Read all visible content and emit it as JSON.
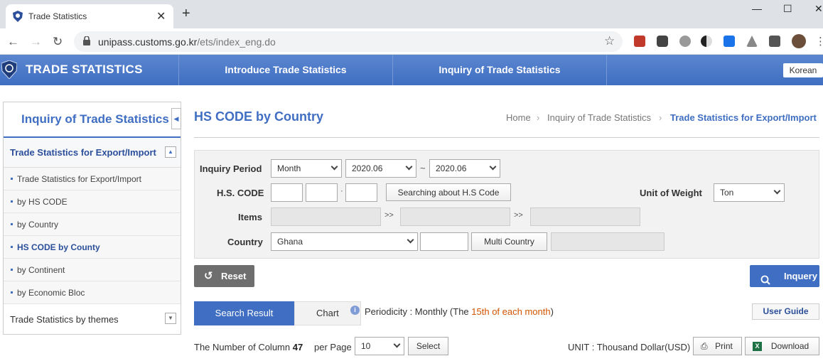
{
  "browser": {
    "tab_title": "Trade Statistics",
    "url_host": "unipass.customs.go.kr",
    "url_path": "/ets/index_eng.do"
  },
  "site": {
    "brand": "TRADE STATISTICS",
    "menu": [
      "Introduce Trade Statistics",
      "Inquiry of Trade Statistics"
    ],
    "lang_button": "Korean"
  },
  "sidebar": {
    "title": "Inquiry of Trade Statistics",
    "section": "Trade Statistics for Export/Import",
    "items": [
      "Trade Statistics for Export/Import",
      "by HS CODE",
      "by Country",
      "HS CODE by County",
      "by Continent",
      "by Economic Bloc"
    ],
    "footer_section": "Trade Statistics by themes"
  },
  "page": {
    "title": "HS CODE by Country",
    "breadcrumb": [
      "Home",
      "Inquiry of Trade Statistics",
      "Trade Statistics for Export/Import"
    ]
  },
  "form": {
    "period_label": "Inquiry Period",
    "period_type": "Month",
    "period_from": "2020.06",
    "tilde": "~",
    "period_to": "2020.06",
    "hs_label": "H.S. CODE",
    "hs_dot": "·",
    "hs_search_button": "Searching about H.S Code",
    "weight_label": "Unit of Weight",
    "weight_value": "Ton",
    "items_label": "Items",
    "arrow": ">>",
    "country_label": "Country",
    "country_value": "Ghana",
    "multi_country_button": "Multi Country"
  },
  "actions": {
    "reset": "Reset",
    "inquiry": "Inquery"
  },
  "results": {
    "tab_search": "Search Result",
    "tab_chart": "Chart",
    "periodicity_prefix": "Periodicity : Monthly (The ",
    "periodicity_highlight": "15th of each month",
    "periodicity_suffix": ")",
    "user_guide": "User Guide",
    "column_label": "The Number of Column",
    "column_count": "47",
    "per_page_label": "per Page",
    "per_page_value": "10",
    "select_button": "Select",
    "unit_text": "UNIT : Thousand Dollar(USD)",
    "print": "Print",
    "download": "Download"
  },
  "colors": {
    "brand_blue": "#3f6ec2",
    "highlight_orange": "#d35400"
  }
}
